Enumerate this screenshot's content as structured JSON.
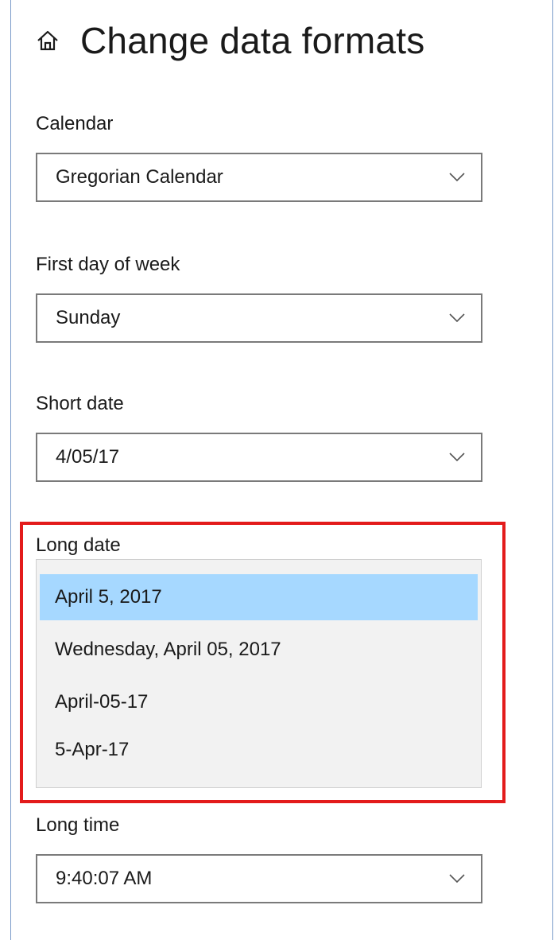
{
  "header": {
    "title": "Change data formats",
    "icon": "home-icon"
  },
  "fields": {
    "calendar": {
      "label": "Calendar",
      "value": "Gregorian Calendar"
    },
    "first_day": {
      "label": "First day of week",
      "value": "Sunday"
    },
    "short_date": {
      "label": "Short date",
      "value": "4/05/17"
    },
    "long_date": {
      "label": "Long date",
      "options": [
        "April 5, 2017",
        "Wednesday, April 05, 2017",
        "April-05-17",
        "5-Apr-17"
      ],
      "selected_index": 0
    },
    "long_time": {
      "label": "Long time",
      "value": "9:40:07 AM"
    }
  },
  "colors": {
    "highlight_border": "#e31b1b",
    "selected_option_bg": "#a6d8ff",
    "dropdown_bg": "#f2f2f2"
  }
}
